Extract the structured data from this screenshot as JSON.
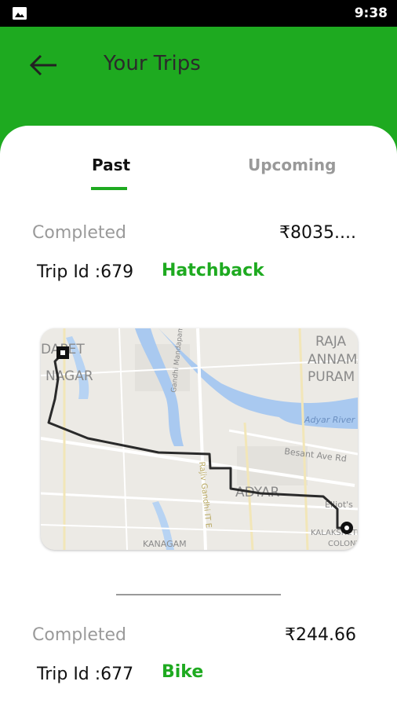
{
  "status_bar": {
    "time": "9:38"
  },
  "header": {
    "title": "Your Trips"
  },
  "tabs": [
    {
      "label": "Past",
      "active": true
    },
    {
      "label": "Upcoming",
      "active": false
    }
  ],
  "trips": [
    {
      "status": "Completed",
      "price": "₹8035....",
      "trip_id": "Trip Id :679",
      "vehicle": "Hatchback"
    },
    {
      "status": "Completed",
      "price": "₹244.66",
      "trip_id": "Trip Id :677",
      "vehicle": "Bike"
    }
  ],
  "map_labels": {
    "l1": "DAPET",
    "l2": "NAGAR",
    "l3": "RAJA",
    "l4": "ANNAMA",
    "l5": "PURAM",
    "l6": "Adyar River",
    "l7": "Gandhi Mandapam Rd",
    "l8": "Besant Ave Rd",
    "l9": "ADYAR",
    "l10": "Rajiv Gandhi IT E",
    "l11": "Elliot's",
    "l12": "KALAKSHETRA",
    "l13": "COLONY",
    "l14": "KANAGAM"
  },
  "colors": {
    "accent": "#1eaa20",
    "route": "#2a2a2a",
    "water": "#a9c9f0"
  }
}
